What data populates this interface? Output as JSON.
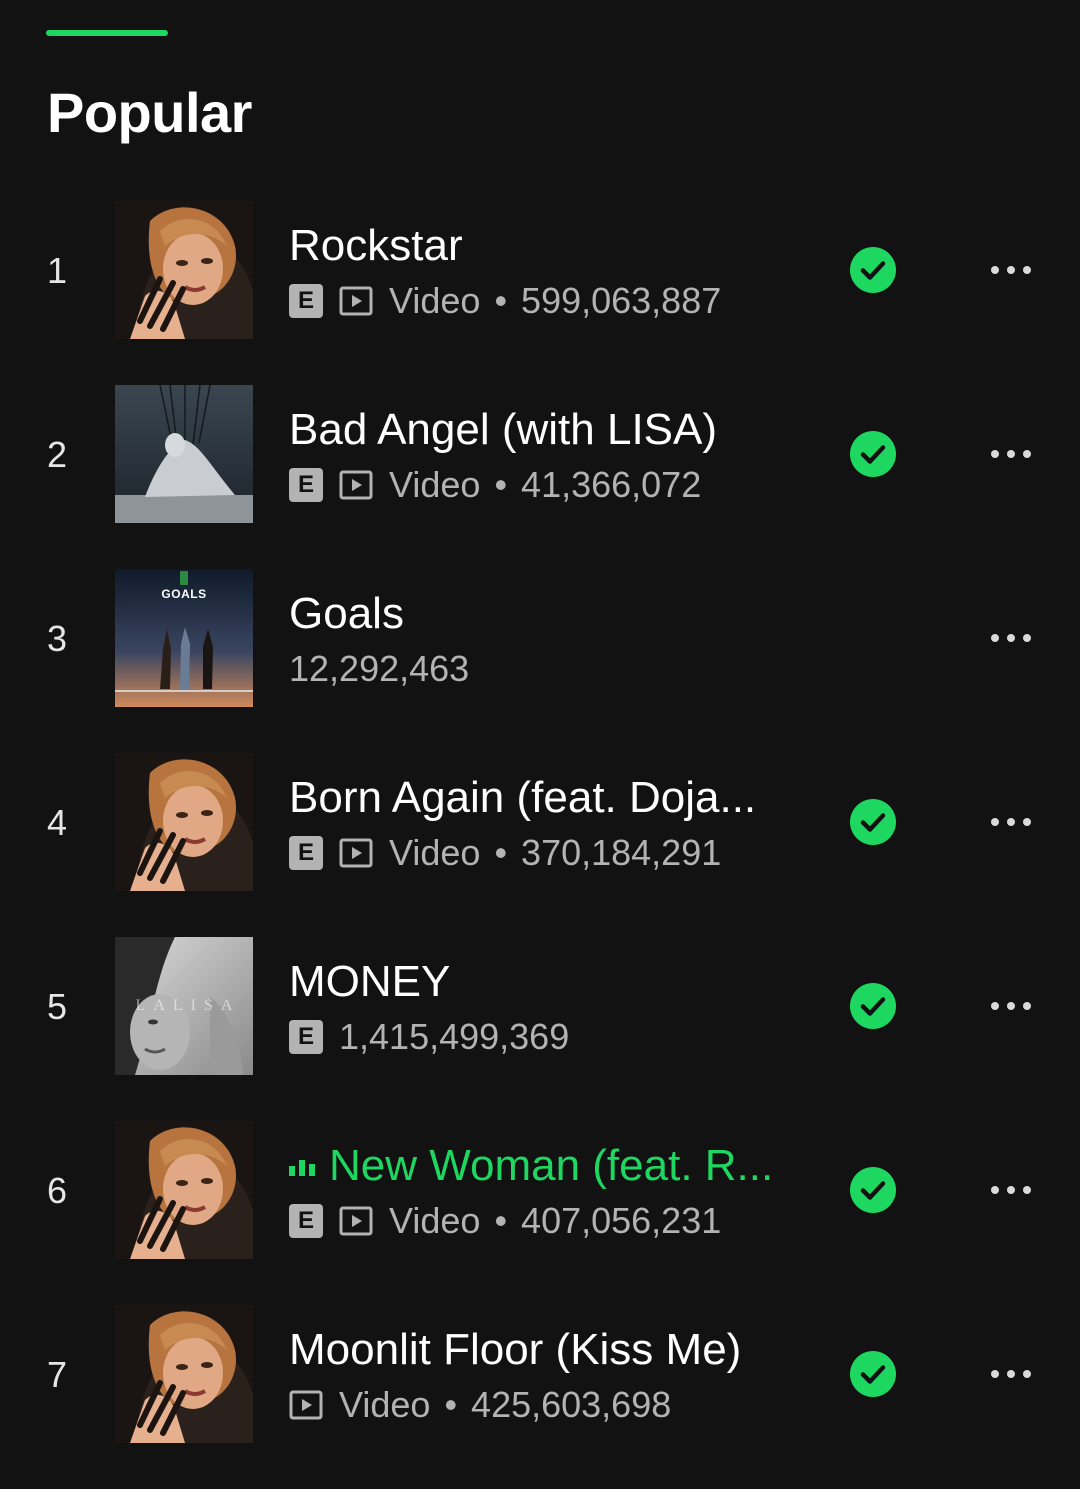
{
  "section": {
    "title": "Popular"
  },
  "colors": {
    "background": "#121212",
    "accent": "#1ed760",
    "secondary_text": "#b3b3b3"
  },
  "icons": {
    "explicit": "explicit-badge-icon",
    "video": "video-play-icon",
    "saved": "check-circle-icon",
    "more": "more-options-icon",
    "now_playing": "equalizer-bars-icon"
  },
  "tracks": [
    {
      "rank": "1",
      "title": "Rockstar",
      "explicit": "E",
      "has_video": true,
      "video_label": "Video",
      "separator": "•",
      "plays": "599,063,887",
      "saved": true,
      "playing": false,
      "cover": "lisa-portrait"
    },
    {
      "rank": "2",
      "title": "Bad Angel (with LISA)",
      "explicit": "E",
      "has_video": true,
      "video_label": "Video",
      "separator": "•",
      "plays": "41,366,072",
      "saved": true,
      "playing": false,
      "cover": "bad-angel-sculpture"
    },
    {
      "rank": "3",
      "title": "Goals",
      "explicit": "",
      "has_video": false,
      "video_label": "",
      "separator": "",
      "plays": "12,292,463",
      "saved": false,
      "playing": false,
      "cover": "goals-poster",
      "cover_text": "GOALS"
    },
    {
      "rank": "4",
      "title": "Born Again (feat. Doja...",
      "explicit": "E",
      "has_video": true,
      "video_label": "Video",
      "separator": "•",
      "plays": "370,184,291",
      "saved": true,
      "playing": false,
      "cover": "lisa-portrait"
    },
    {
      "rank": "5",
      "title": "MONEY",
      "explicit": "E",
      "has_video": false,
      "video_label": "",
      "separator": "",
      "plays": "1,415,499,369",
      "saved": true,
      "playing": false,
      "cover": "lalisa-bw",
      "cover_text": "LALISA"
    },
    {
      "rank": "6",
      "title": "New Woman (feat. R...",
      "explicit": "E",
      "has_video": true,
      "video_label": "Video",
      "separator": "•",
      "plays": "407,056,231",
      "saved": true,
      "playing": true,
      "cover": "lisa-portrait"
    },
    {
      "rank": "7",
      "title": "Moonlit Floor (Kiss Me)",
      "explicit": "",
      "has_video": true,
      "video_label": "Video",
      "separator": "•",
      "plays": "425,603,698",
      "saved": true,
      "playing": false,
      "cover": "lisa-portrait"
    }
  ]
}
